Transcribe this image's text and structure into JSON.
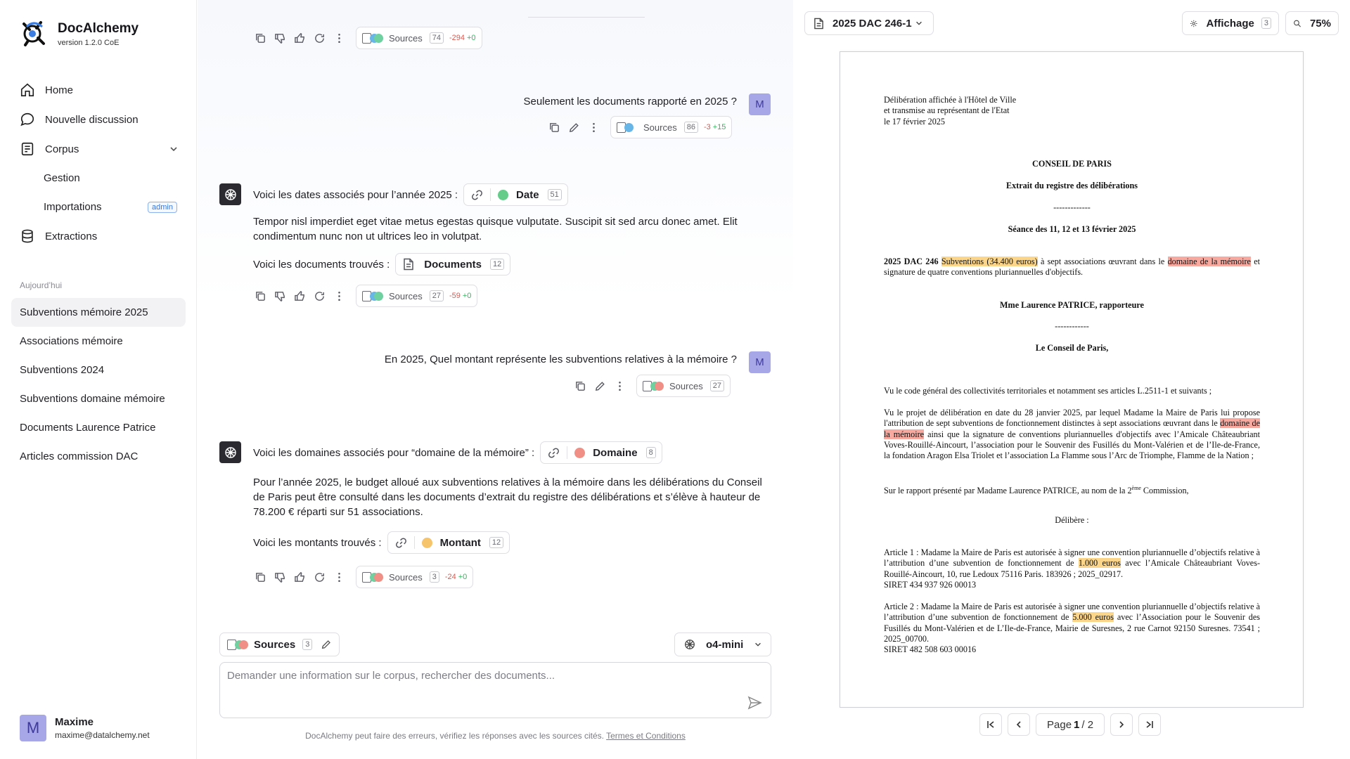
{
  "brand": {
    "name": "DocAlchemy",
    "version": "version 1.2.0 CoE"
  },
  "nav": {
    "home": "Home",
    "new_chat": "Nouvelle discussion",
    "corpus": "Corpus",
    "gestion": "Gestion",
    "importations": "Importations",
    "admin_badge": "admin",
    "extractions": "Extractions"
  },
  "history": {
    "title": "Aujourd’hui",
    "items": [
      "Subventions mémoire 2025",
      "Associations mémoire",
      "Subventions 2024",
      "Subventions domaine mémoire",
      "Documents Laurence Patrice",
      "Articles commission DAC"
    ]
  },
  "user": {
    "initial": "M",
    "name": "Maxime",
    "email": "maxime@datalchemy.net"
  },
  "chat": {
    "sources_label": "Sources",
    "msg0": {
      "sources_count": "74",
      "delta_neg": "-294",
      "delta_pos": "+0"
    },
    "user1": {
      "text": "Seulement les documents rapporté en 2025 ?",
      "sources_count": "86",
      "delta_neg": "-3",
      "delta_pos": "+15"
    },
    "bot1": {
      "intro": "Voici les dates associés pour l’année 2025 :",
      "tag_label": "Date",
      "tag_count": "51",
      "tag_color": "#66cc8a",
      "para": "Tempor nisl imperdiet eget vitae metus egestas quisque vulputate. Suscipit sit sed arcu donec amet. Elit condimentum nunc non ut ultrices leo in volutpat.",
      "docs_intro": "Voici les documents trouvés :",
      "docs_label": "Documents",
      "docs_count": "12",
      "sources_count": "27",
      "delta_neg": "-59",
      "delta_pos": "+0"
    },
    "user2": {
      "text": "En 2025, Quel montant représente les subventions relatives à la mémoire ?",
      "sources_count": "27"
    },
    "bot2": {
      "intro": "Voici les domaines associés pour “domaine de la mémoire” :",
      "tag_label": "Domaine",
      "tag_count": "8",
      "tag_color": "#ef8f86",
      "para": "Pour l’année 2025, le budget alloué aux subventions relatives à la mémoire dans les délibérations du Conseil de Paris peut être consulté dans les documents d’extrait du registre des délibérations et s’élève à hauteur de 78.200 € réparti sur 51 associations.",
      "amounts_intro": "Voici les montants trouvés :",
      "amounts_label": "Montant",
      "amounts_count": "12",
      "amounts_color": "#f6c46a",
      "sources_count": "3",
      "delta_neg": "-24",
      "delta_pos": "+0"
    },
    "composer": {
      "sources_label": "Sources",
      "sources_count": "3",
      "model": "o4-mini",
      "placeholder": "Demander une information sur le corpus, rechercher des documents...",
      "disclaimer": "DocAlchemy peut faire des erreurs, vérifiez les réponses avec les sources cités.",
      "terms": "Termes et Conditions"
    }
  },
  "viewer": {
    "doc_name": "2025 DAC 246-1",
    "display_label": "Affichage",
    "display_count": "3",
    "zoom": "75%",
    "page_prefix": "Page",
    "page_current": "1",
    "page_sep": "/ 2",
    "page": {
      "header1": "Délibération affichée à l'Hôtel de Ville",
      "header2": "et transmise au représentant de l'Etat",
      "header3": "le 17 février 2025",
      "title1": "CONSEIL DE PARIS",
      "title2": "Extrait du registre des délibérations",
      "dashes": "-------------",
      "seance": "Séance des 11, 12 et 13 février 2025",
      "dac_ref": "2025 DAC 246",
      "dac_hl1": "Subventions (34.400 euros)",
      "dac_mid": "à sept associations œuvrant dans le",
      "dac_hl2": "domaine de la mémoire",
      "dac_end": "et signature de quatre conventions pluriannuelles d'objectifs.",
      "rapporteur": "Mme Laurence PATRICE, rapporteure",
      "dashes2": "------------",
      "conseil": "Le Conseil de Paris,",
      "vu1": "Vu le code général des collectivités territoriales et notamment ses articles L.2511-1 et suivants ;",
      "vu2_a": "Vu le projet de délibération en date du 28 janvier 2025, par lequel Madame la Maire de Paris lui propose l'attribution de sept subventions de fonctionnement distinctes à sept associations œuvrant dans le",
      "vu2_hl": "domaine de la mémoire",
      "vu2_b": "ainsi que la signature de conventions pluriannuelles d'objectifs avec l’Amicale Châteaubriant Voves-Rouillé-Aincourt, l’association pour le Souvenir des Fusillés du Mont-Valérien et de l’Ile-de-France, la fondation Aragon Elsa Triolet et l’association La Flamme sous l’Arc de Triomphe, Flamme de la Nation ;",
      "rapport_a": "Sur le rapport présenté par Madame Laurence PATRICE, au nom de la 2",
      "rapport_sup": "ème",
      "rapport_b": "Commission,",
      "delibere": "Délibère :",
      "art1_a": "Article 1 : Madame la Maire de Paris est autorisée à signer une convention pluriannuelle d’objectifs relative à l’attribution d’une subvention de fonctionnement de",
      "art1_hl": "1.000 euros",
      "art1_b": "avec l’Amicale Châteaubriant Voves-Rouillé-Aincourt, 10, rue Ledoux 75116 Paris. 183926 ; 2025_02917.",
      "art1_siret": "SIRET 434 937 926 00013",
      "art2_a": "Article 2 : Madame la Maire de Paris est autorisée à signer une convention pluriannuelle d’objectifs relative à l’attribution d’une subvention de fonctionnement de",
      "art2_hl": "5.000 euros",
      "art2_b": "avec l’Association pour le Souvenir des Fusillés du Mont-Valérien et de L’Ile-de-France, Mairie de Suresnes, 2 rue Carnot 92150 Suresnes. 73541 ; 2025_00700.",
      "art2_siret": "SIRET 482 508 603 00016"
    }
  }
}
